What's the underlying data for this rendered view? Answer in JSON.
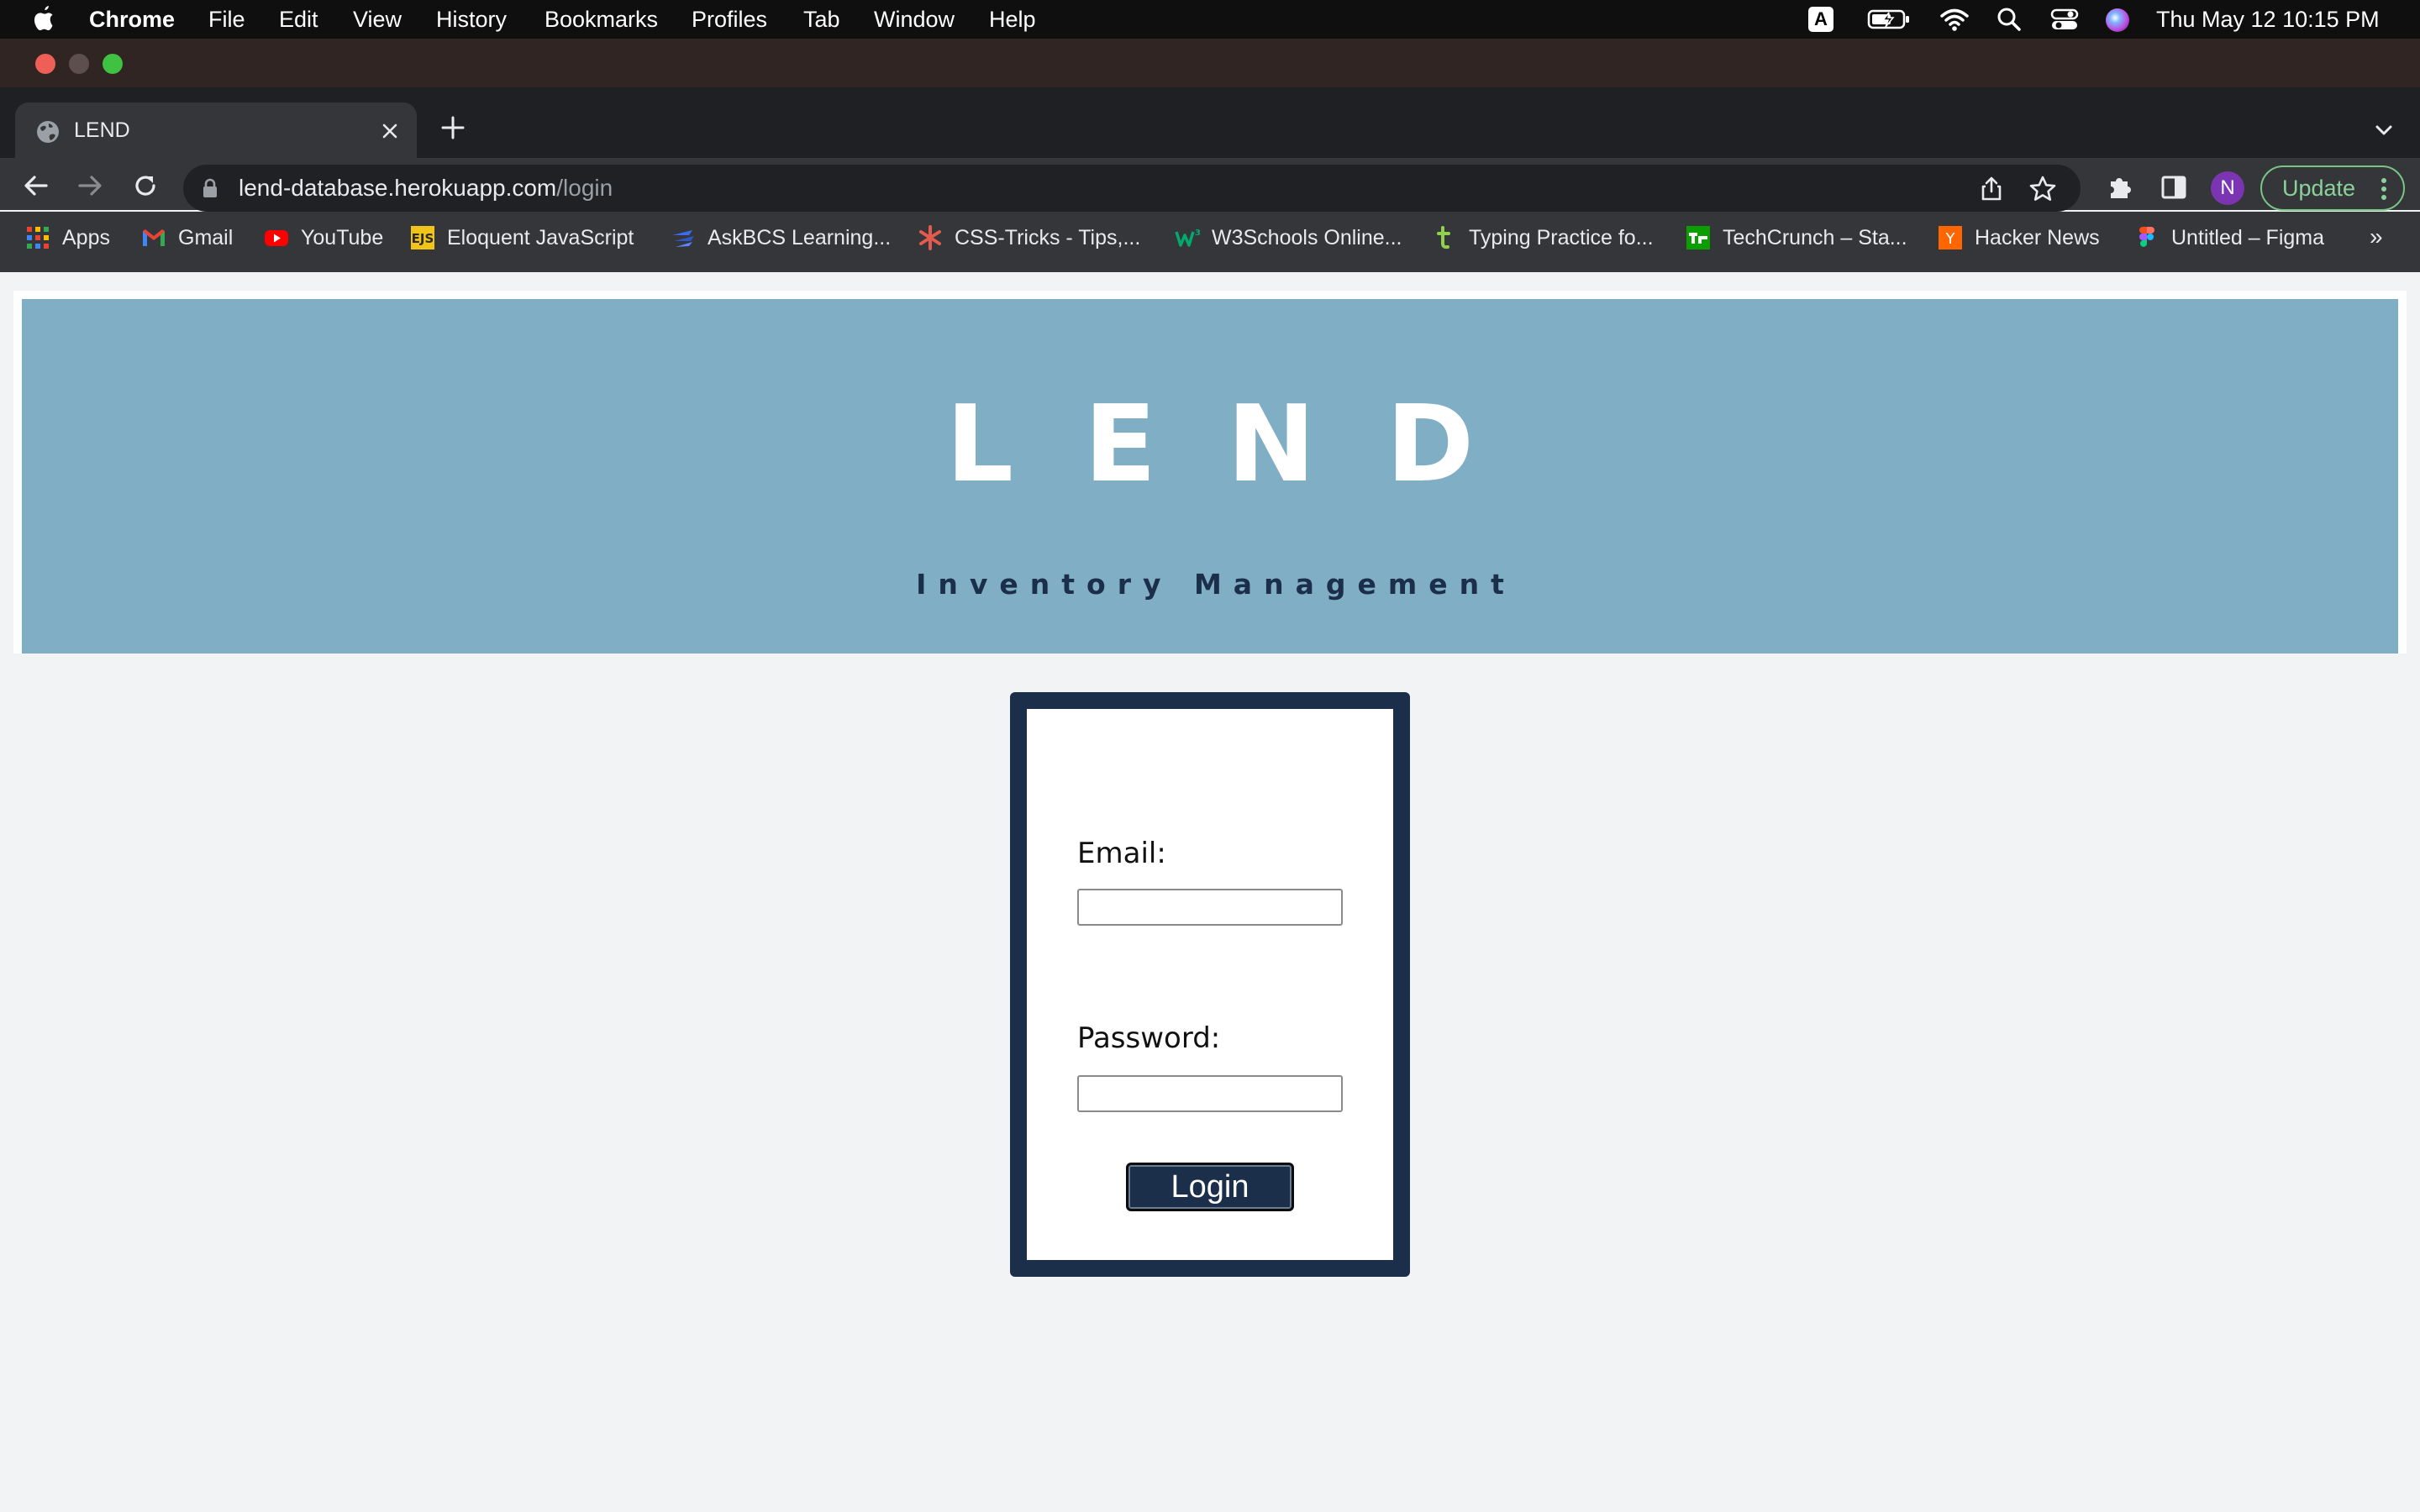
{
  "menubar": {
    "app": "Chrome",
    "items": [
      "File",
      "Edit",
      "View",
      "History",
      "Bookmarks",
      "Profiles",
      "Tab",
      "Window",
      "Help"
    ],
    "clock": "Thu May 12  10:15 PM",
    "input_indicator": "A"
  },
  "tab": {
    "title": "LEND"
  },
  "omnibox": {
    "host": "lend-database.herokuapp.com",
    "path": "/login"
  },
  "profile": {
    "initial": "N"
  },
  "update_label": "Update",
  "bookmarks": [
    {
      "label": "Apps",
      "icon": "apps-grid-icon"
    },
    {
      "label": "Gmail",
      "icon": "gmail-icon"
    },
    {
      "label": "YouTube",
      "icon": "youtube-icon"
    },
    {
      "label": "Eloquent JavaScript",
      "icon": "ejs-icon"
    },
    {
      "label": "AskBCS Learning...",
      "icon": "askbcs-icon"
    },
    {
      "label": "CSS-Tricks - Tips,...",
      "icon": "css-tricks-icon"
    },
    {
      "label": "W3Schools Online...",
      "icon": "w3schools-icon"
    },
    {
      "label": "Typing Practice fo...",
      "icon": "typing-icon"
    },
    {
      "label": "TechCrunch – Sta...",
      "icon": "techcrunch-icon"
    },
    {
      "label": "Hacker News",
      "icon": "hacker-news-icon"
    },
    {
      "label": "Untitled – Figma",
      "icon": "figma-icon"
    }
  ],
  "bookmarks_more": "»",
  "banner": {
    "brand": "LEND",
    "tagline": "Inventory Management"
  },
  "login": {
    "email_label": "Email:",
    "email_value": "",
    "password_label": "Password:",
    "password_value": "",
    "button_label": "Login"
  },
  "colors": {
    "banner_bg": "#80aec4",
    "brand_text": "#ffffff",
    "tagline_text": "#1b2e4a",
    "card_border": "#1b2e4a",
    "button_bg": "#1b2e4a",
    "page_bg": "#f2f3f5"
  }
}
